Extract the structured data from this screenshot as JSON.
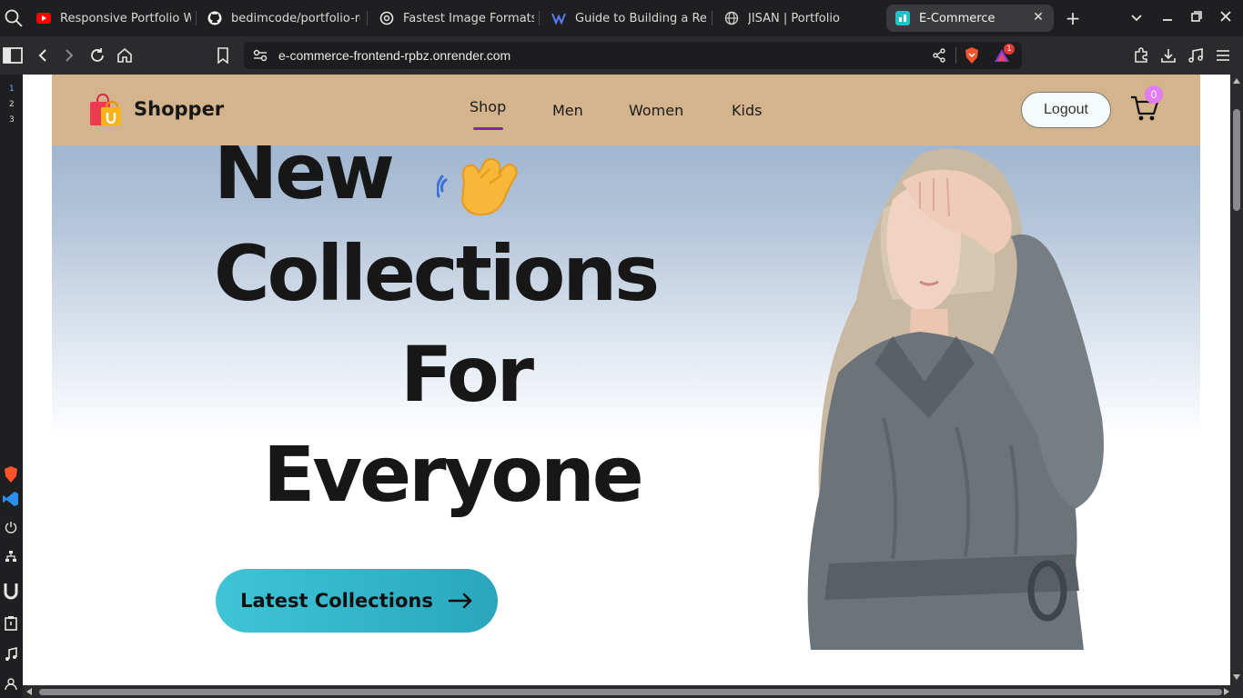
{
  "browser": {
    "tabs": [
      {
        "label": "Responsive Portfolio We",
        "icon": "youtube-icon",
        "color": "#ff0000"
      },
      {
        "label": "bedimcode/portfolio-re",
        "icon": "github-icon",
        "color": "#ffffff"
      },
      {
        "label": "Fastest Image Formats",
        "icon": "openai-icon",
        "color": "#ffffff"
      },
      {
        "label": "Guide to Building a Resp",
        "icon": "site-icon",
        "color": "#5a7cff"
      },
      {
        "label": "JISAN | Portfolio",
        "icon": "globe-icon",
        "color": "#cccccc"
      },
      {
        "label": "E-Commerce",
        "icon": "site-icon",
        "color": "#27c0c9",
        "active": true
      }
    ],
    "url": "e-commerce-frontend-rpbz.onrender.com",
    "sidebar_numbers": [
      "1",
      "2",
      "3"
    ],
    "notification_count": "1"
  },
  "site": {
    "brand": "Shopper",
    "nav": [
      "Shop",
      "Men",
      "Women",
      "Kids"
    ],
    "active_nav": "Shop",
    "logout_label": "Logout",
    "cart_count": "0",
    "colors": {
      "navbar": "#d3b48c",
      "accent_underline": "#7b2c9e",
      "cta": "#3ec5d6",
      "badge": "#e37bf2"
    }
  },
  "hero": {
    "lines": [
      "New",
      "Collections",
      "For",
      "Everyone"
    ],
    "cta_label": "Latest Collections"
  }
}
